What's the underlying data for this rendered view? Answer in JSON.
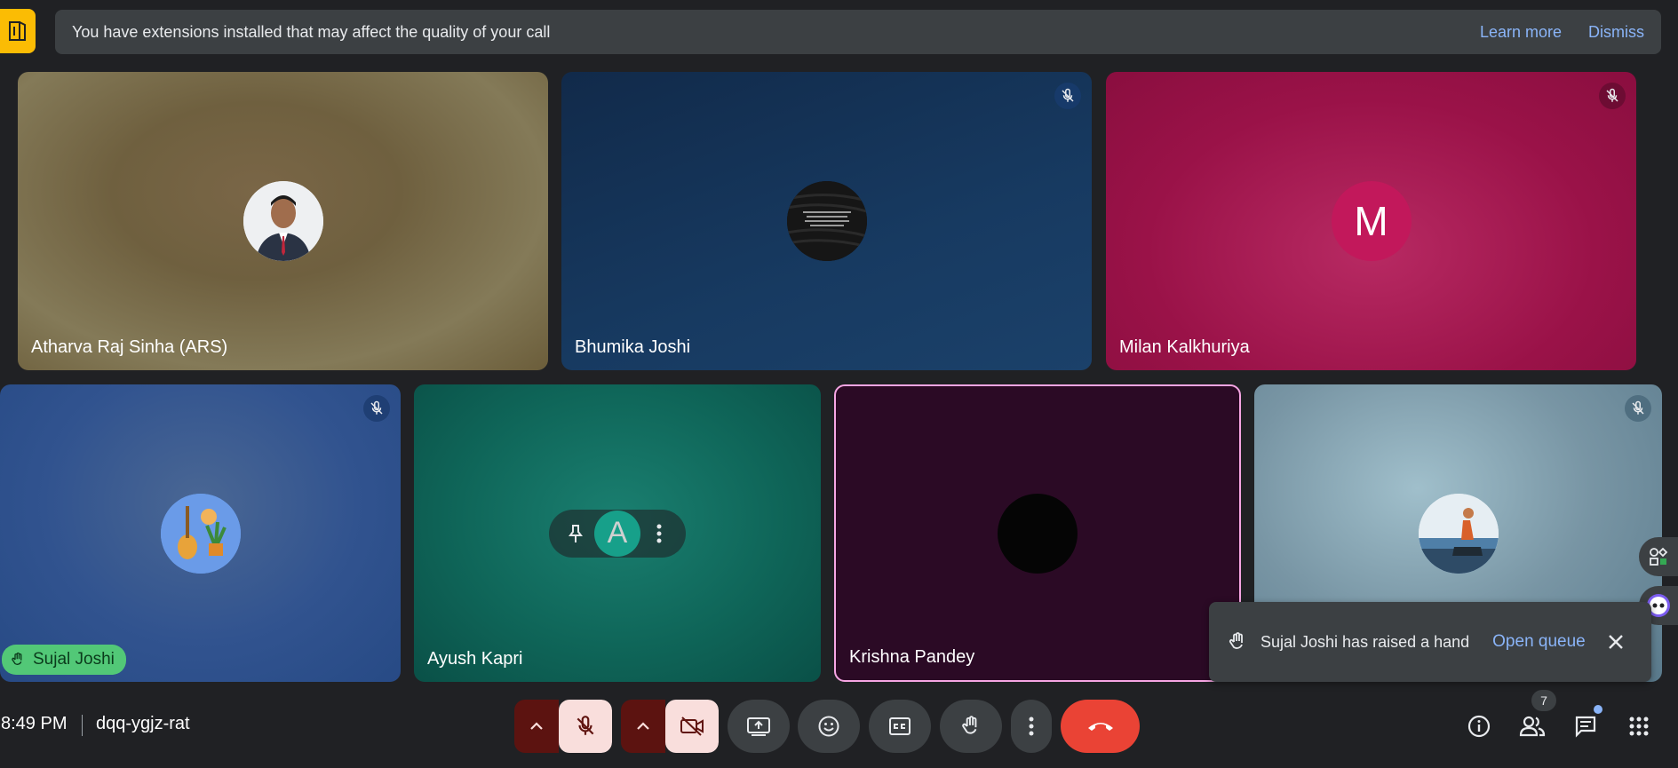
{
  "banner": {
    "message": "You have extensions installed that may affect the quality of your call",
    "learn_more": "Learn more",
    "dismiss": "Dismiss"
  },
  "participants": [
    {
      "name": "Atharva Raj Sinha (ARS)",
      "muted": false,
      "avatar": "photo"
    },
    {
      "name": "Bhumika Joshi",
      "muted": true,
      "avatar": "photo"
    },
    {
      "name": "Milan Kalkhuriya",
      "muted": true,
      "avatar_letter": "M",
      "avatar_color": "#c2185b"
    },
    {
      "name": "Sujal Joshi",
      "muted": true,
      "hand_raised": true,
      "avatar": "illustration"
    },
    {
      "name": "Ayush Kapri",
      "muted": false,
      "avatar_letter": "A",
      "avatar_color": "#17a08a"
    },
    {
      "name": "Krishna Pandey",
      "muted": false,
      "active_speaker": true,
      "avatar": "photo"
    },
    {
      "name": "",
      "muted": true,
      "avatar": "photo"
    }
  ],
  "toast": {
    "message": "Sujal Joshi has raised a hand",
    "action": "Open queue"
  },
  "bottom_bar": {
    "time": "8:49 PM",
    "meeting_code": "dqq-ygjz-rat",
    "people_count": "7"
  },
  "colors": {
    "end_call": "#ea4335",
    "muted_control_bg": "#f9dedc",
    "accent_link": "#8ab4f8",
    "hand_badge": "#52c877",
    "active_speaker_border": "#f6a5e3"
  }
}
